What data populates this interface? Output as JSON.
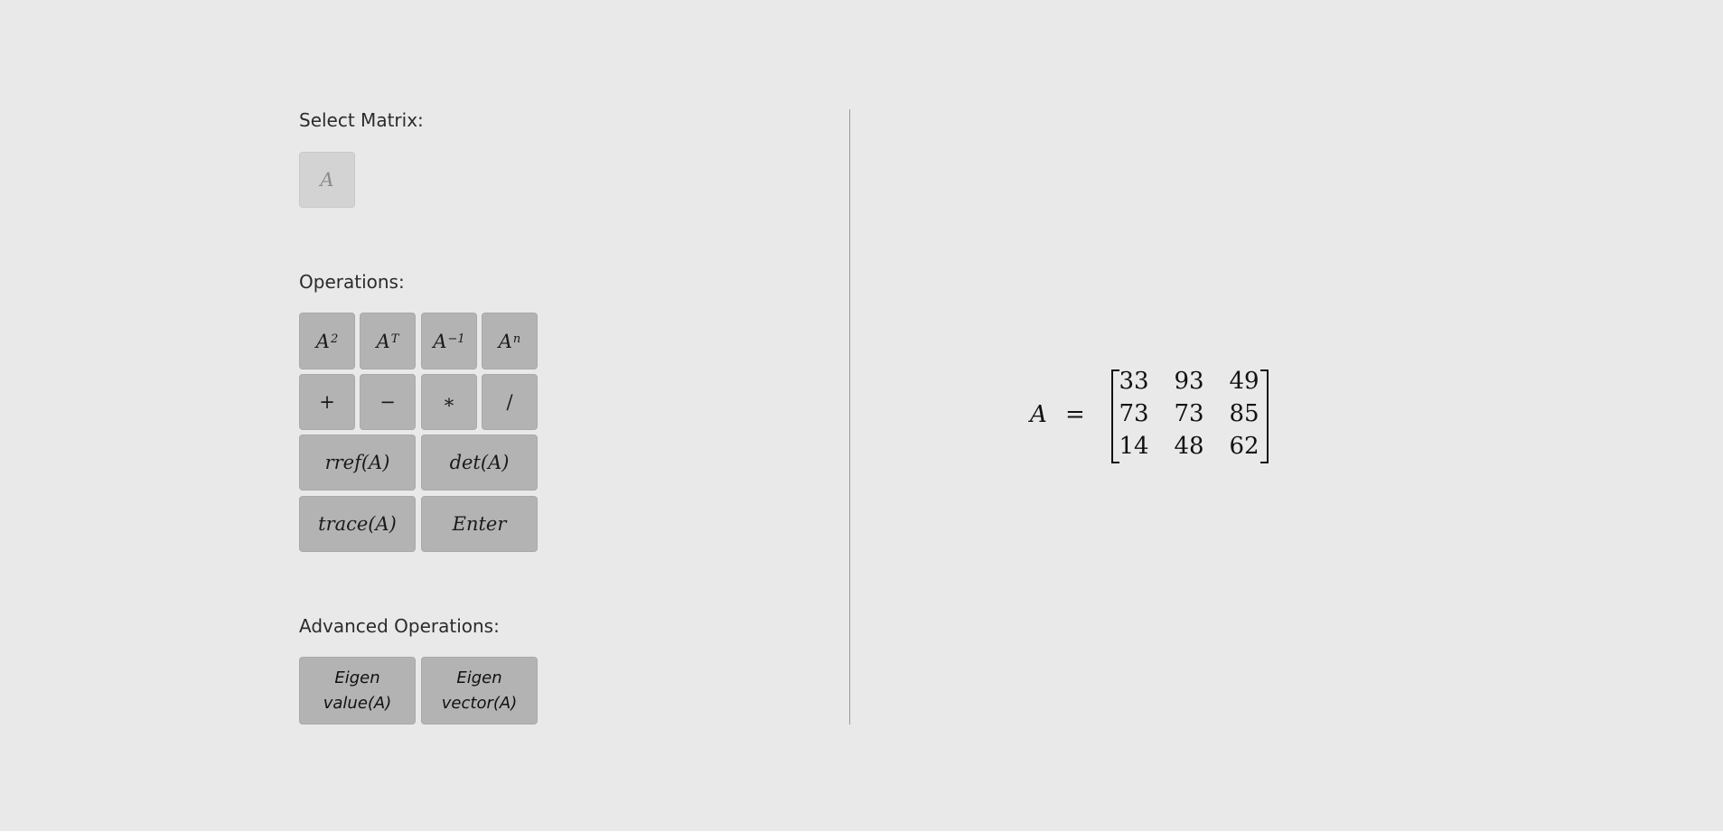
{
  "select_matrix": {
    "label": "Select Matrix:",
    "matrices": [
      "A"
    ]
  },
  "operations": {
    "label": "Operations:",
    "a_squared": {
      "base": "A",
      "exp": "2"
    },
    "a_transpose": {
      "base": "A",
      "exp": "T"
    },
    "a_inverse": {
      "base": "A",
      "exp": "−1"
    },
    "a_power_n": {
      "base": "A",
      "exp": "n"
    },
    "plus": "+",
    "minus": "−",
    "multiply": "∗",
    "divide": "/",
    "rref": "rref(A)",
    "det": "det(A)",
    "trace": "trace(A)",
    "enter": "Enter"
  },
  "advanced_operations": {
    "label": "Advanced Operations:",
    "eigenvalue": {
      "line1": "Eigen",
      "line2": "value(A)"
    },
    "eigenvector": {
      "line1": "Eigen",
      "line2": "vector(A)"
    }
  },
  "display": {
    "matrix_name": "A",
    "equals": "=",
    "rows": [
      [
        "33",
        "93",
        "49"
      ],
      [
        "73",
        "73",
        "85"
      ],
      [
        "14",
        "48",
        "62"
      ]
    ]
  }
}
